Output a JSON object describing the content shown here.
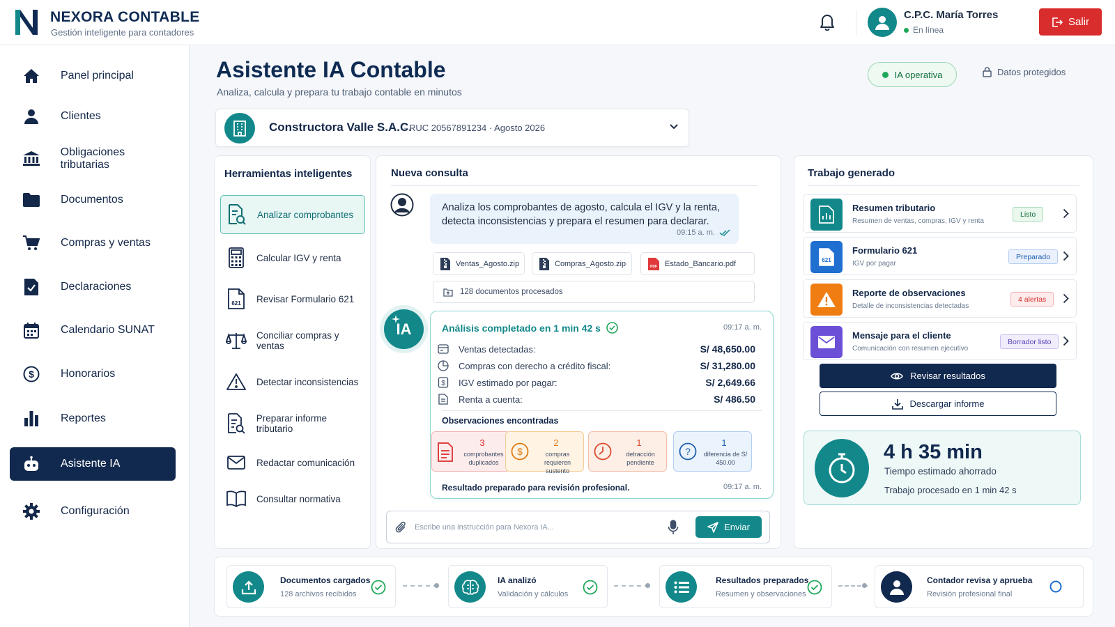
{
  "brand": {
    "name": "NEXORA CONTABLE",
    "tagline": "Gestión inteligente para contadores"
  },
  "header": {
    "user_name": "C.P.C. María Torres",
    "user_status": "En línea",
    "logout_label": "Salir"
  },
  "sidebar": {
    "items": [
      {
        "label": "Panel principal",
        "icon": "home-icon"
      },
      {
        "label": "Clientes",
        "icon": "user-icon"
      },
      {
        "label": "Obligaciones tributarias",
        "icon": "bank-icon"
      },
      {
        "label": "Documentos",
        "icon": "folder-icon"
      },
      {
        "label": "Compras y ventas",
        "icon": "cart-icon"
      },
      {
        "label": "Declaraciones",
        "icon": "document-check-icon"
      },
      {
        "label": "Calendario SUNAT",
        "icon": "calendar-icon"
      },
      {
        "label": "Honorarios",
        "icon": "dollar-circle-icon"
      },
      {
        "label": "Reportes",
        "icon": "bar-chart-icon"
      },
      {
        "label": "Asistente IA",
        "icon": "robot-icon",
        "active": true
      },
      {
        "label": "Configuración",
        "icon": "gear-icon"
      }
    ]
  },
  "page": {
    "title": "Asistente IA Contable",
    "subtitle": "Analiza, calcula y prepara tu trabajo contable en minutos",
    "ia_status": "IA operativa",
    "security_label": "Datos protegidos"
  },
  "client": {
    "name": "Constructora Valle S.A.C.",
    "meta": "·  RUC 20567891234  ·  Agosto 2026"
  },
  "tools": {
    "title": "Herramientas inteligentes",
    "items": [
      {
        "label": "Analizar comprobantes",
        "icon": "document-search-icon",
        "active": true
      },
      {
        "label": "Calcular IGV y renta",
        "icon": "calculator-icon"
      },
      {
        "label": "Revisar Formulario 621",
        "icon": "form-621-icon"
      },
      {
        "label": "Conciliar compras y ventas",
        "icon": "scale-icon"
      },
      {
        "label": "Detectar inconsistencias",
        "icon": "warning-icon"
      },
      {
        "label": "Preparar informe tributario",
        "icon": "report-search-icon"
      },
      {
        "label": "Redactar comunicación",
        "icon": "mail-icon"
      },
      {
        "label": "Consultar normativa",
        "icon": "book-icon"
      }
    ]
  },
  "chat": {
    "title": "Nueva consulta",
    "user_message": "Analiza los comprobantes de agosto, calcula el IGV y la renta, detecta inconsistencias y prepara el resumen para declarar.",
    "user_message_time": "09:15 a. m.",
    "files": [
      "Ventas_Agosto.zip",
      "Compras_Agosto.zip",
      "Estado_Bancario.pdf"
    ],
    "docs_processed": "128 documentos procesados",
    "ia_badge": "IA",
    "result": {
      "title": "Análisis completado en 1 min 42 s",
      "time": "09:17 a. m.",
      "metrics": [
        {
          "label": "Ventas detectadas:",
          "value": "S/  48,650.00",
          "icon": "receipt-icon"
        },
        {
          "label": "Compras con derecho a crédito fiscal:",
          "value": "S/  31,280.00",
          "icon": "pie-icon"
        },
        {
          "label": "IGV estimado por pagar:",
          "value": "S/  2,649.66",
          "icon": "dollar-doc-icon"
        },
        {
          "label": "Renta a cuenta:",
          "value": "S/  486.50",
          "icon": "note-icon"
        }
      ],
      "observations_title": "Observaciones encontradas",
      "observations": [
        {
          "count": "3",
          "text": "comprobantes duplicados",
          "color": "#d92d2d"
        },
        {
          "count": "2",
          "text": "compras requieren sustento",
          "color": "#e07b12"
        },
        {
          "count": "1",
          "text": "detracción pendiente",
          "color": "#d94a2d"
        },
        {
          "count": "1",
          "text": "diferencia de S/ 450.00",
          "color": "#1f5fae"
        }
      ],
      "footer": "Resultado preparado para revisión profesional.",
      "footer_time": "09:17 a. m."
    },
    "input_placeholder": "Escribe una instrucción para Nexora IA...",
    "send_label": "Enviar"
  },
  "work": {
    "title": "Trabajo generado",
    "items": [
      {
        "title": "Resumen tributario",
        "subtitle": "Resumen de ventas, compras, IGV y renta",
        "badge": "Listo",
        "icon": "report-chart-icon",
        "color": "#12888a"
      },
      {
        "title": "Formulario 621",
        "subtitle": "IGV por pagar",
        "badge": "Preparado",
        "icon": "form-621-icon",
        "color": "#1f6fd1"
      },
      {
        "title": "Reporte de observaciones",
        "subtitle": "Detalle de inconsistencias detectadas",
        "badge": "4 alertas",
        "icon": "warning-icon",
        "color": "#ef7d12"
      },
      {
        "title": "Mensaje para el cliente",
        "subtitle": "Comunicación con resumen ejecutivo",
        "badge": "Borrador listo",
        "icon": "mail-icon",
        "color": "#6b4fd6"
      }
    ],
    "review_label": "Revisar resultados",
    "download_label": "Descargar informe",
    "saved": {
      "value": "4 h 35 min",
      "label": "Tiempo estimado ahorrado",
      "sub": "Trabajo procesado en 1 min 42 s"
    }
  },
  "workflow": [
    {
      "title": "Documentos cargados",
      "subtitle": "128 archivos recibidos",
      "state": "done",
      "icon": "upload-icon"
    },
    {
      "title": "IA analizó",
      "subtitle": "Validación y cálculos",
      "state": "done",
      "icon": "brain-icon"
    },
    {
      "title": "Resultados preparados",
      "subtitle": "Resumen y observaciones",
      "state": "done",
      "icon": "list-icon"
    },
    {
      "title": "Contador revisa y aprueba",
      "subtitle": "Revisión profesional final",
      "state": "pending",
      "icon": "user-icon"
    }
  ]
}
